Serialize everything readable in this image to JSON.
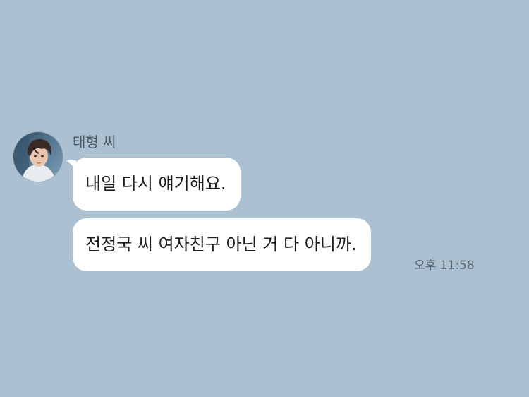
{
  "chat": {
    "sender": {
      "name": "태형 씨",
      "avatar_icon": "profile-photo"
    },
    "messages": [
      {
        "text": "내일 다시 얘기해요."
      },
      {
        "text": "전정국 씨 여자친구 아닌 거 다 아니까."
      }
    ],
    "timestamp": "오후 11:58"
  },
  "colors": {
    "background": "#abc1d1",
    "bubble": "#ffffff",
    "text": "#1c1c1c",
    "meta_text": "#5d6a75"
  }
}
